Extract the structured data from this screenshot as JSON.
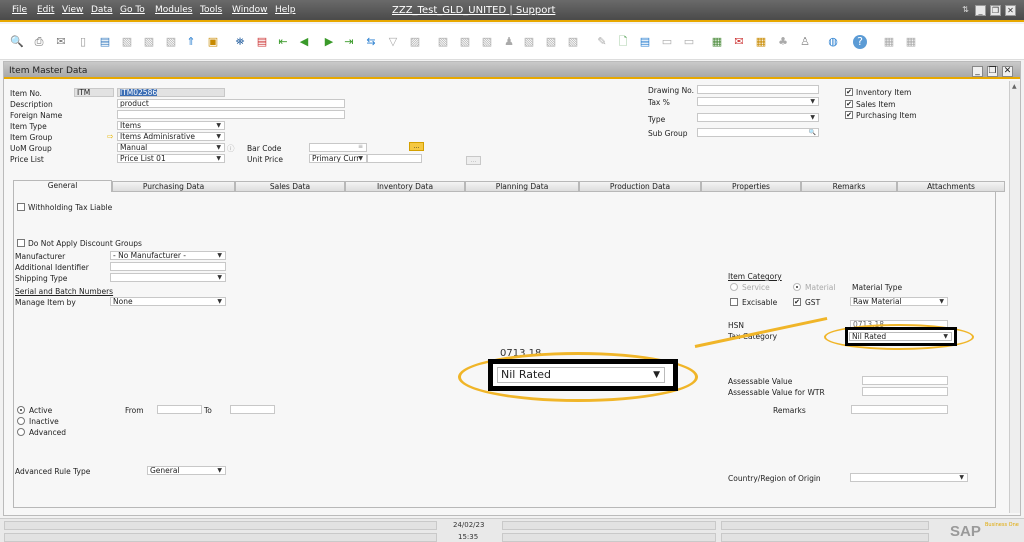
{
  "menubar": {
    "items": [
      "File",
      "Edit",
      "View",
      "Data",
      "Go To",
      "Modules",
      "Tools",
      "Window",
      "Help"
    ],
    "app_title": "ZZZ_Test_GLD_UNITED | Support"
  },
  "toolbar": {
    "icons": [
      "preview-icon",
      "print-icon",
      "email-icon",
      "sms-icon",
      "fax-icon",
      "export-excel-icon",
      "export-word-icon",
      "export-pdf-icon",
      "launch-app-icon",
      "lock-screen-icon",
      "find-icon",
      "add-icon",
      "first-record-icon",
      "previous-record-icon",
      "next-record-icon",
      "last-record-icon",
      "refresh-icon",
      "filter-icon",
      "sort-icon",
      "base-document-icon",
      "target-document-icon",
      "copy-icon",
      "gross-profit-icon",
      "relationship-map-icon",
      "alerts-icon",
      "draw-icon",
      "new-document-icon",
      "settings-icon",
      "message-icon",
      "chat-icon",
      "calendar-icon",
      "inbox-icon",
      "reports-icon",
      "org-chart-icon",
      "user-icon",
      "web-icon",
      "help-icon",
      "form-settings-icon",
      "layout-icon"
    ]
  },
  "window": {
    "title": "Item Master Data"
  },
  "header": {
    "item_no_label": "Item No.",
    "item_no_series": "ITM",
    "item_no_value": "ITM02586",
    "description_label": "Description",
    "description_value": "product",
    "foreign_name_label": "Foreign Name",
    "foreign_name_value": "",
    "item_type_label": "Item Type",
    "item_type_value": "Items",
    "item_group_label": "Item Group",
    "item_group_value": "Items Adminisrative",
    "uom_group_label": "UoM Group",
    "uom_group_value": "Manual",
    "price_list_label": "Price List",
    "price_list_value": "Price List 01",
    "bar_code_label": "Bar Code",
    "bar_code_value": "",
    "unit_price_label": "Unit Price",
    "unit_price_currency": "Primary Curr",
    "unit_price_value": "",
    "drawing_no_label": "Drawing No.",
    "tax_pct_label": "Tax %",
    "type_label": "Type",
    "sub_group_label": "Sub Group",
    "inventory_item_label": "Inventory Item",
    "sales_item_label": "Sales Item",
    "purchasing_item_label": "Purchasing Item",
    "inventory_item_checked": true,
    "sales_item_checked": true,
    "purchasing_item_checked": true
  },
  "tabs": [
    "General",
    "Purchasing Data",
    "Sales Data",
    "Inventory Data",
    "Planning Data",
    "Production Data",
    "Properties",
    "Remarks",
    "Attachments"
  ],
  "active_tab": "General",
  "general": {
    "withholding_tax_label": "Withholding Tax Liable",
    "do_not_apply_discount_label": "Do Not Apply Discount Groups",
    "manufacturer_label": "Manufacturer",
    "manufacturer_value": "- No Manufacturer -",
    "additional_identifier_label": "Additional Identifier",
    "shipping_type_label": "Shipping Type",
    "serial_batch_label": "Serial and Batch Numbers",
    "manage_item_by_label": "Manage Item by",
    "manage_item_by_value": "None",
    "status_active": "Active",
    "status_inactive": "Inactive",
    "status_advanced": "Advanced",
    "from_label": "From",
    "to_label": "To",
    "advanced_rule_type_label": "Advanced Rule Type",
    "advanced_rule_type_value": "General",
    "item_category_label": "Item Category",
    "service_label": "Service",
    "material_label": "Material",
    "material_type_label": "Material Type",
    "material_type_value": "Raw Material",
    "excisable_label": "Excisable",
    "gst_label": "GST",
    "hsn_label": "HSN",
    "hsn_value": "0713.18",
    "tax_category_label": "Tax Category",
    "tax_category_value": "Nil Rated",
    "assessable_value_label": "Assessable Value",
    "assessable_value_wtr_label": "Assessable Value for WTR",
    "remarks_label": "Remarks",
    "country_origin_label": "Country/Region of Origin"
  },
  "callout": {
    "hsn_partial": "0713.18",
    "value": "Nil Rated",
    "highlight_color": "#f0b528"
  },
  "statusbar": {
    "date": "24/02/23",
    "time": "15:35",
    "brand": "SAP",
    "brand_sub": "Business One"
  }
}
